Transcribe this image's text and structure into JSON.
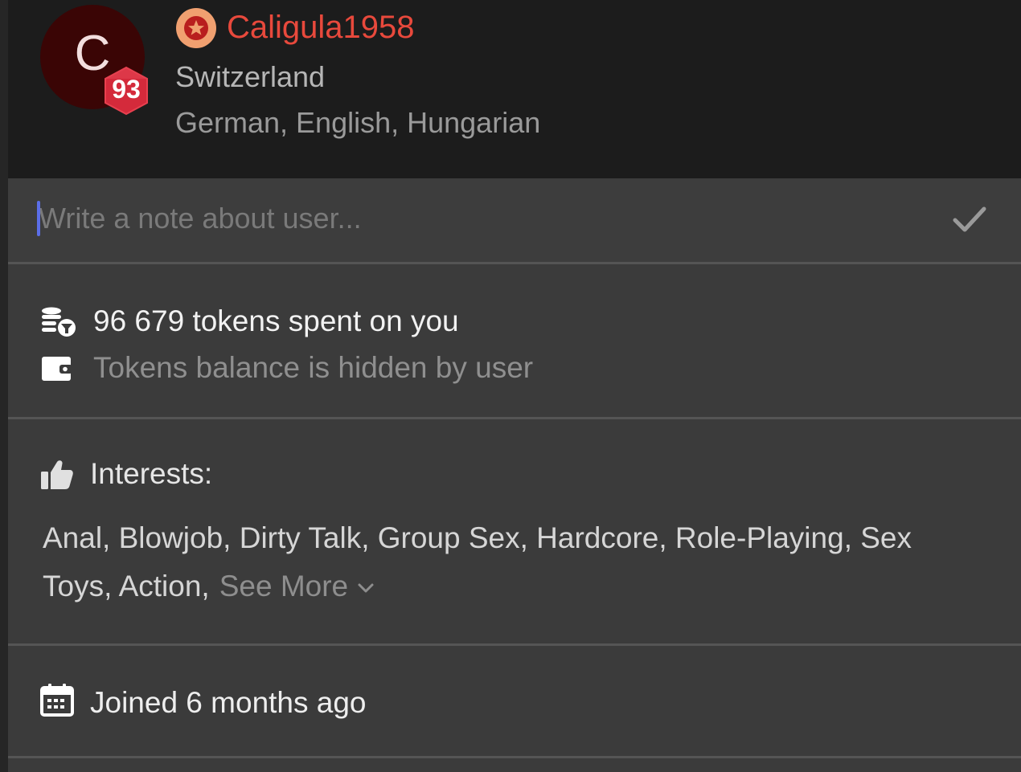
{
  "user": {
    "avatar_letter": "C",
    "level": "93",
    "username": "Caligula1958",
    "country": "Switzerland",
    "languages": "German, English, Hungarian",
    "rank_icon": "star-badge-icon",
    "username_color": "#e8493c"
  },
  "note": {
    "placeholder": "Write a note about user...",
    "value": "",
    "submit_icon": "checkmark-icon"
  },
  "tokens": {
    "spent_icon": "coins-stack-icon",
    "spent_text": "96 679 tokens spent on you",
    "balance_icon": "wallet-icon",
    "balance_text": "Tokens balance is hidden by user"
  },
  "interests": {
    "icon": "thumbs-up-icon",
    "title": "Interests:",
    "list_text": "Anal, Blowjob, Dirty Talk, Group Sex, Hardcore, Role-Playing, Sex Toys, Action,",
    "see_more_label": "See More",
    "see_more_icon": "chevron-down-icon"
  },
  "joined": {
    "icon": "calendar-icon",
    "text": "Joined 6 months ago"
  },
  "colors": {
    "header_bg": "#1c1c1c",
    "panel_bg": "#3b3b3b",
    "level_badge": "#d42a3b",
    "rank_badge": "#f0a070"
  }
}
